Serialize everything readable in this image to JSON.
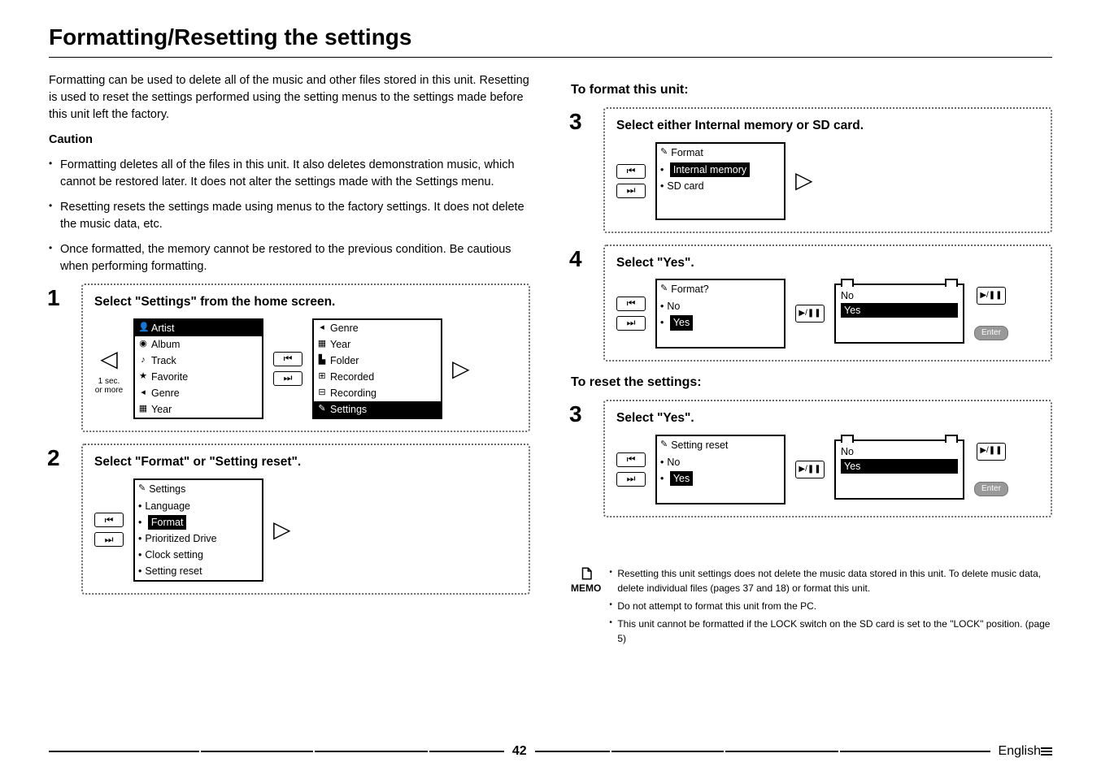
{
  "title": "Formatting/Resetting the settings",
  "intro": "Formatting can be used to delete all of the music and other files stored in this unit. Resetting is used to reset the settings performed using the setting menus to the settings made before this unit left the factory.",
  "caution_h": "Caution",
  "caution": [
    "Formatting deletes all of the files in this unit. It also deletes demonstration music, which cannot be restored later. It does not alter the settings made with the Settings menu.",
    "Resetting resets the settings made using menus to the factory settings. It does not delete the music data, etc.",
    "Once formatted, the memory cannot be restored to the previous condition. Be cautious when performing formatting."
  ],
  "steps_left": {
    "s1": {
      "num": "1",
      "title": "Select \"Settings\" from the home screen.",
      "sec_note": "1 sec. or more",
      "shot_a": {
        "items": [
          "Artist",
          "Album",
          "Track",
          "Favorite",
          "Genre",
          "Year"
        ],
        "hl_index": 0
      },
      "shot_b": {
        "items": [
          "Genre",
          "Year",
          "Folder",
          "Recorded",
          "Recording",
          "Settings"
        ],
        "hl_index": 5
      }
    },
    "s2": {
      "num": "2",
      "title": "Select \"Format\" or \"Setting reset\".",
      "shot": {
        "head": "Settings",
        "items": [
          "Language",
          "Format",
          "Prioritized Drive",
          "Clock setting",
          "Setting reset"
        ],
        "hl_index": 1
      }
    }
  },
  "right": {
    "format_h": "To format this unit:",
    "s3": {
      "num": "3",
      "title": "Select either Internal memory or SD card.",
      "shot": {
        "head": "Format",
        "items": [
          "Internal memory",
          "SD card"
        ],
        "hl_index": 0
      }
    },
    "s4": {
      "num": "4",
      "title": "Select \"Yes\".",
      "shot_a": {
        "head": "Format?",
        "items": [
          "No",
          "Yes"
        ],
        "hl_index": 1
      },
      "confirm": {
        "items": [
          "No",
          "Yes"
        ],
        "hl_index": 1
      },
      "enter": "Enter"
    },
    "reset_h": "To reset the settings:",
    "r3": {
      "num": "3",
      "title": "Select \"Yes\".",
      "shot_a": {
        "head": "Setting reset",
        "items": [
          "No",
          "Yes"
        ],
        "hl_index": 1
      },
      "confirm": {
        "items": [
          "No",
          "Yes"
        ],
        "hl_index": 1
      },
      "enter": "Enter"
    }
  },
  "memo_label": "MEMO",
  "memo": [
    "Resetting this unit settings does not delete the music data stored in this unit. To delete music data, delete individual files (pages 37 and 18) or format this unit.",
    "Do not attempt to format this unit from the PC.",
    "This unit cannot be formatted if the LOCK switch on the SD card is set to the \"LOCK\" position. (page 5)"
  ],
  "page": "42",
  "lang": "English",
  "glyph": {
    "prev": "⏮",
    "next": "⏭",
    "play": "▶/❚❚",
    "left": "◁",
    "right": "▷"
  }
}
